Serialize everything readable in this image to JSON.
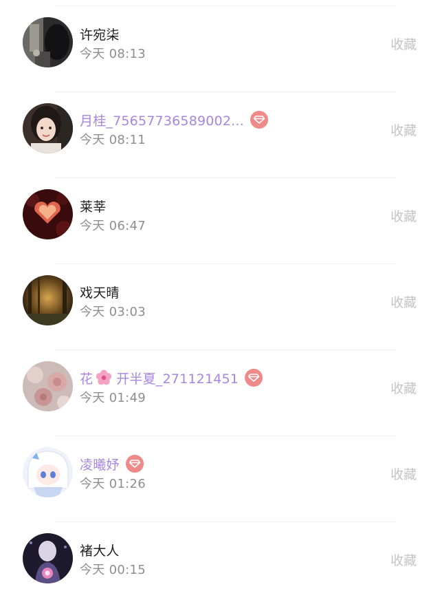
{
  "rows": [
    {
      "name": "许宛柒",
      "vip": false,
      "time": "今天 08:13",
      "action": "收藏"
    },
    {
      "name": "月桂_75657736589002...",
      "vip": true,
      "time": "今天 08:11",
      "action": "收藏"
    },
    {
      "name": "莱莘",
      "vip": false,
      "time": "今天 06:47",
      "action": "收藏"
    },
    {
      "name": "戏天晴",
      "vip": false,
      "time": "今天 03:03",
      "action": "收藏"
    },
    {
      "name_prefix": "花",
      "name_suffix": "开半夏_271121451",
      "vip": true,
      "time": "今天 01:49",
      "action": "收藏"
    },
    {
      "name": "凌曦妤",
      "vip": true,
      "time": "今天 01:26",
      "action": "收藏"
    },
    {
      "name": "褚大人",
      "vip": false,
      "time": "今天 00:15",
      "action": "收藏"
    }
  ],
  "icons": {
    "vip_badge": "diamond-icon",
    "flower": "cherry-blossom-icon"
  },
  "colors": {
    "vip_name": "#a786e0",
    "vip_badge": "#ee8a8a",
    "name": "#1f1f1f",
    "time": "#8e8e92",
    "action": "#c4c4c8",
    "divider": "#f1f1f3"
  }
}
